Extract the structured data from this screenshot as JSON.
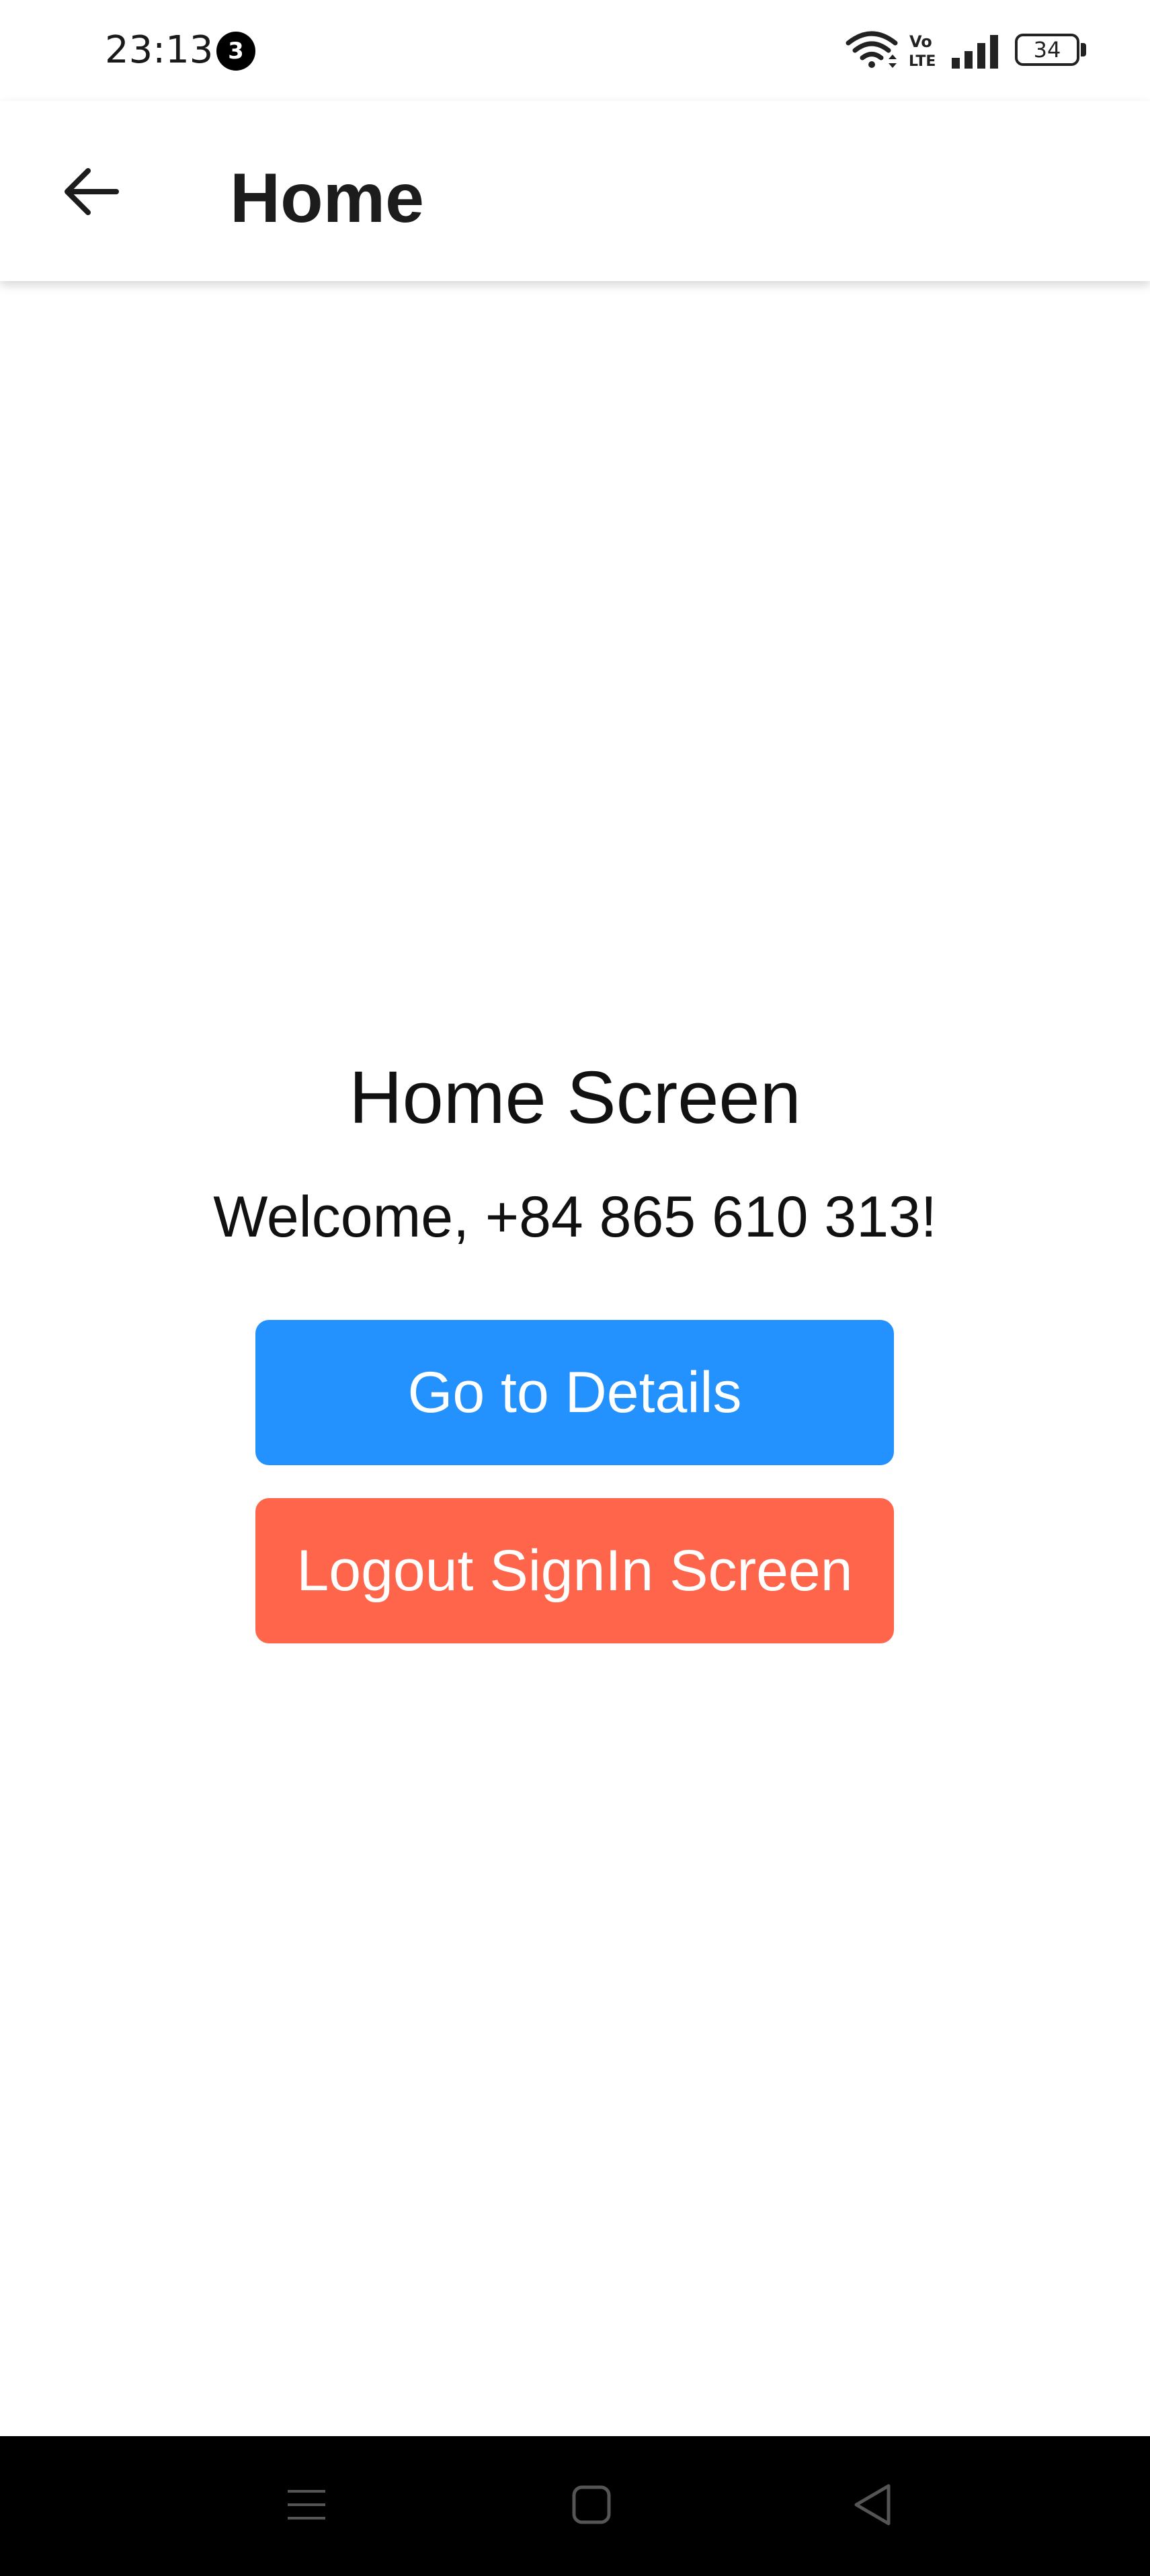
{
  "status_bar": {
    "time": "23:13",
    "notification_count": "3",
    "battery_level": "34",
    "icons": [
      "wifi-icon",
      "volte-icon",
      "signal-icon",
      "battery-icon"
    ]
  },
  "app_bar": {
    "title": "Home",
    "back_icon": "arrow-back-icon"
  },
  "main": {
    "heading": "Home Screen",
    "welcome": "Welcome, +84 865 610 313!",
    "details_button_label": "Go to Details",
    "logout_button_label": "Logout SignIn Screen"
  },
  "nav_bar": {
    "icons": [
      "menu-icon",
      "home-icon",
      "back-icon"
    ]
  },
  "colors": {
    "details_button": "#2391fe",
    "logout_button": "#ff654b",
    "nav_bar": "#000000"
  }
}
